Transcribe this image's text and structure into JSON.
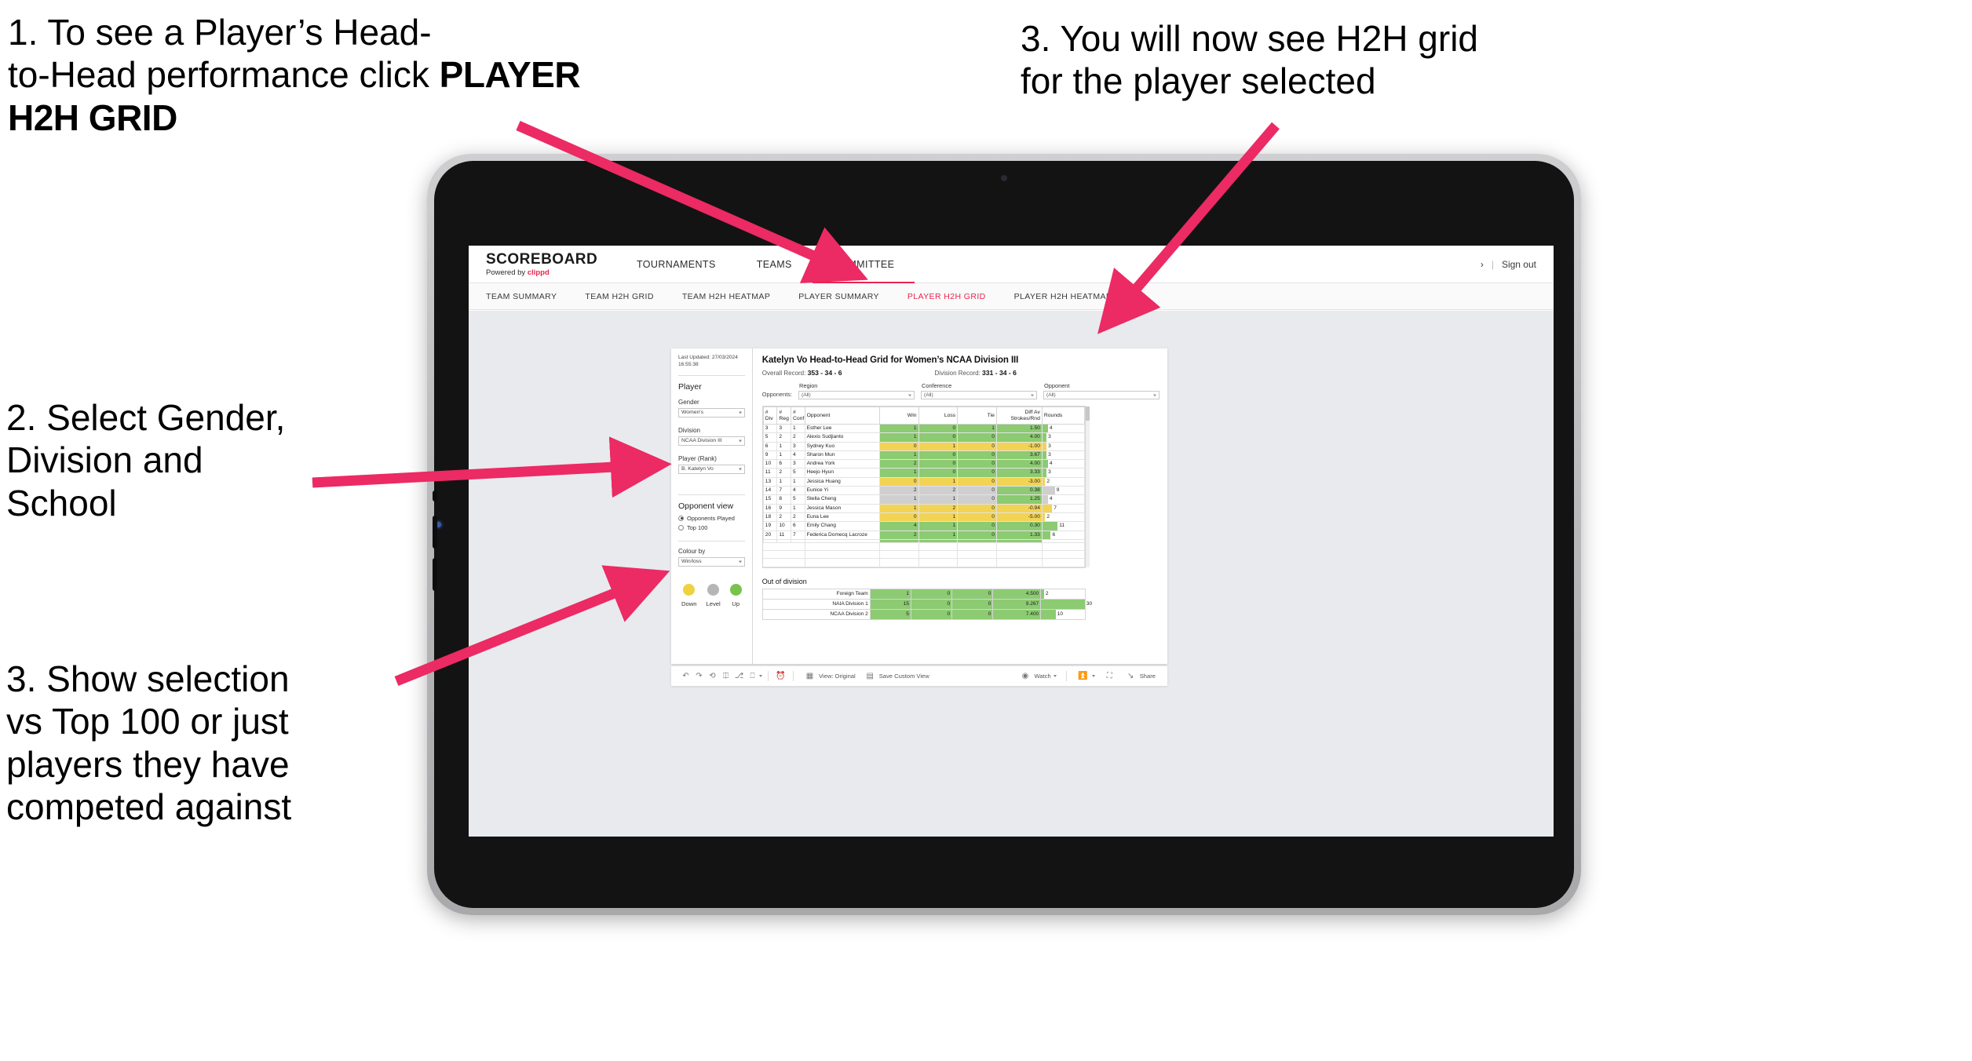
{
  "annotations": {
    "step1_line1": "1. To see a Player’s Head-\nto-Head performance click ",
    "step1_bold": "PLAYER H2H GRID",
    "step2": "2. Select Gender,\nDivision and\nSchool",
    "step3_top": "3. You will now see H2H grid\nfor the player selected",
    "step3_left": "3. Show selection\nvs Top 100 or just\nplayers they have\ncompeted against",
    "arrow_color": "#ec2a63"
  },
  "app": {
    "logo_word": "SCOREBOARD",
    "logo_sub_prefix": "Powered by ",
    "logo_brand": "clippd",
    "top_nav": [
      {
        "label": "TOURNAMENTS",
        "active": false
      },
      {
        "label": "TEAMS",
        "active": false
      },
      {
        "label": "COMMITTEE",
        "active": true
      }
    ],
    "top_right": {
      "chevron": "›",
      "separator": "|",
      "sign_out": "Sign out"
    },
    "sub_nav": [
      {
        "label": "TEAM SUMMARY",
        "active": false
      },
      {
        "label": "TEAM H2H GRID",
        "active": false
      },
      {
        "label": "TEAM H2H HEATMAP",
        "active": false
      },
      {
        "label": "PLAYER SUMMARY",
        "active": false
      },
      {
        "label": "PLAYER H2H GRID",
        "active": true
      },
      {
        "label": "PLAYER H2H HEATMAP",
        "active": false
      }
    ],
    "accent_color": "#e8254e"
  },
  "panel": {
    "last_updated": "Last Updated: 27/03/2024\n16:55:38",
    "player_title": "Player",
    "gender_label": "Gender",
    "gender_value": "Women's",
    "division_label": "Division",
    "division_value": "NCAA Division III",
    "player_rank_label": "Player (Rank)",
    "player_rank_value": "B. Katelyn Vo",
    "opponent_view_title": "Opponent view",
    "opponent_view_options": [
      {
        "label": "Opponents Played",
        "selected": true
      },
      {
        "label": "Top 100",
        "selected": false
      }
    ],
    "colour_by_label": "Colour by",
    "colour_by_value": "Win/loss",
    "legend": [
      {
        "label": "Down",
        "color": "#efd23f"
      },
      {
        "label": "Level",
        "color": "#b6b6b6"
      },
      {
        "label": "Up",
        "color": "#79c24e"
      }
    ]
  },
  "viz": {
    "title": "Katelyn Vo Head-to-Head Grid for Women’s NCAA Division III",
    "overall_record_label": "Overall Record: ",
    "overall_record_value": "353 -  34 - 6",
    "division_record_label": "Division Record: ",
    "division_record_value": "331 -  34 - 6",
    "opponents_label": "Opponents:",
    "filters": [
      {
        "label": "Region",
        "value": "(All)"
      },
      {
        "label": "Conference",
        "value": "(All)"
      },
      {
        "label": "Opponent",
        "value": "(All)"
      }
    ]
  },
  "chart_data": {
    "type": "table",
    "title": "Katelyn Vo Head-to-Head Grid for Women’s NCAA Division III",
    "columns": [
      "# Div",
      "# Reg",
      "# Conf",
      "Opponent",
      "Win",
      "Loss",
      "Tie",
      "Diff Av Strokes/Rnd",
      "Rounds"
    ],
    "rounds_max": 30,
    "rows": [
      {
        "div": "3",
        "reg": "3",
        "conf": "1",
        "opponent": "Esther Lee",
        "win": "1",
        "loss": "0",
        "tie": "1",
        "diff": "1.50",
        "rounds": "4",
        "state": "win"
      },
      {
        "div": "5",
        "reg": "2",
        "conf": "2",
        "opponent": "Alexis Sudjianto",
        "win": "1",
        "loss": "0",
        "tie": "0",
        "diff": "4.00",
        "rounds": "3",
        "state": "win"
      },
      {
        "div": "6",
        "reg": "1",
        "conf": "3",
        "opponent": "Sydney Kuo",
        "win": "0",
        "loss": "1",
        "tie": "0",
        "diff": "-1.00",
        "rounds": "3",
        "state": "loss"
      },
      {
        "div": "9",
        "reg": "1",
        "conf": "4",
        "opponent": "Sharon Mun",
        "win": "1",
        "loss": "0",
        "tie": "0",
        "diff": "3.67",
        "rounds": "3",
        "state": "win"
      },
      {
        "div": "10",
        "reg": "6",
        "conf": "3",
        "opponent": "Andrea York",
        "win": "2",
        "loss": "0",
        "tie": "0",
        "diff": "4.00",
        "rounds": "4",
        "state": "win"
      },
      {
        "div": "11",
        "reg": "2",
        "conf": "5",
        "opponent": "Heejo Hyun",
        "win": "1",
        "loss": "0",
        "tie": "0",
        "diff": "3.33",
        "rounds": "3",
        "state": "win"
      },
      {
        "div": "13",
        "reg": "1",
        "conf": "1",
        "opponent": "Jessica Huang",
        "win": "0",
        "loss": "1",
        "tie": "0",
        "diff": "-3.00",
        "rounds": "2",
        "state": "loss"
      },
      {
        "div": "14",
        "reg": "7",
        "conf": "4",
        "opponent": "Eunice Yi",
        "win": "2",
        "loss": "2",
        "tie": "0",
        "diff": "0.38",
        "rounds": "9",
        "state": "level"
      },
      {
        "div": "15",
        "reg": "8",
        "conf": "5",
        "opponent": "Stella Cheng",
        "win": "1",
        "loss": "1",
        "tie": "0",
        "diff": "1.25",
        "rounds": "4",
        "state": "level"
      },
      {
        "div": "16",
        "reg": "9",
        "conf": "1",
        "opponent": "Jessica Mason",
        "win": "1",
        "loss": "2",
        "tie": "0",
        "diff": "-0.94",
        "rounds": "7",
        "state": "loss"
      },
      {
        "div": "18",
        "reg": "2",
        "conf": "2",
        "opponent": "Euna Lee",
        "win": "0",
        "loss": "1",
        "tie": "0",
        "diff": "-5.00",
        "rounds": "2",
        "state": "loss"
      },
      {
        "div": "19",
        "reg": "10",
        "conf": "6",
        "opponent": "Emily Chang",
        "win": "4",
        "loss": "1",
        "tie": "0",
        "diff": "0.30",
        "rounds": "11",
        "state": "win"
      },
      {
        "div": "20",
        "reg": "11",
        "conf": "7",
        "opponent": "Federica Domecq Lacroze",
        "win": "2",
        "loss": "1",
        "tie": "0",
        "diff": "1.33",
        "rounds": "6",
        "state": "win"
      }
    ],
    "out_of_division_title": "Out of division",
    "out_of_division": [
      {
        "name": "Foreign Team",
        "win": "1",
        "loss": "0",
        "tie": "0",
        "diff": "4.500",
        "rounds": "2",
        "state": "win"
      },
      {
        "name": "NAIA Division 1",
        "win": "15",
        "loss": "0",
        "tie": "0",
        "diff": "9.267",
        "rounds": "30",
        "state": "win"
      },
      {
        "name": "NCAA Division 2",
        "win": "5",
        "loss": "0",
        "tie": "0",
        "diff": "7.400",
        "rounds": "10",
        "state": "win"
      }
    ]
  },
  "toolbar": {
    "undo": "undo-icon",
    "redo": "redo-icon",
    "revert": "revert-icon",
    "refresh": "refresh-icon",
    "pause": "pause-icon",
    "view_label": "View: Original",
    "save_custom_view": "Save Custom View",
    "watch": "Watch",
    "share": "Share"
  }
}
